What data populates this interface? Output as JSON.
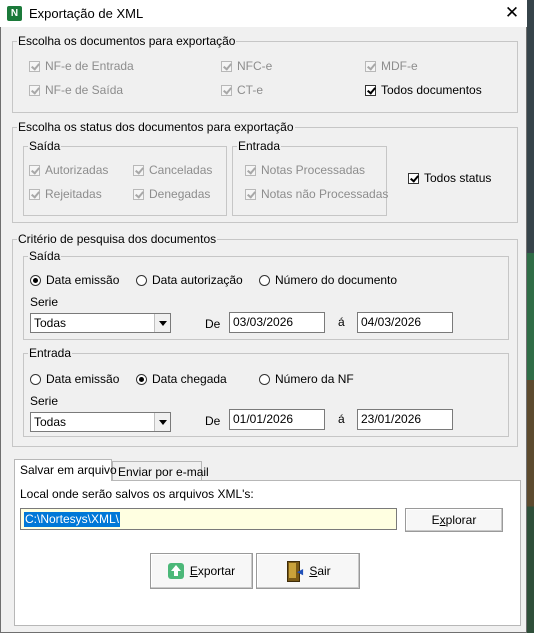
{
  "window": {
    "title": "Exportação de XML",
    "close_glyph": "✕",
    "app_icon_glyph": "N"
  },
  "docs": {
    "legend": "Escolha os documentos para exportação",
    "nfe_entrada": {
      "label": "NF-e de Entrada",
      "checked": true,
      "enabled": false
    },
    "nfce": {
      "label": "NFC-e",
      "checked": true,
      "enabled": false
    },
    "mdfe": {
      "label": "MDF-e",
      "checked": true,
      "enabled": false
    },
    "nfe_saida": {
      "label": "NF-e de Saída",
      "checked": true,
      "enabled": false
    },
    "cte": {
      "label": "CT-e",
      "checked": true,
      "enabled": false
    },
    "todos": {
      "label": "Todos documentos",
      "checked": true,
      "enabled": true
    }
  },
  "status": {
    "legend": "Escolha os status dos documentos para exportação",
    "saida": {
      "legend": "Saída",
      "autorizadas": "Autorizadas",
      "canceladas": "Canceladas",
      "rejeitadas": "Rejeitadas",
      "denegadas": "Denegadas"
    },
    "entrada": {
      "legend": "Entrada",
      "processadas": "Notas Processadas",
      "nao_processadas": "Notas não Processadas"
    },
    "todos": "Todos status"
  },
  "criterio": {
    "legend": "Critério de pesquisa dos documentos",
    "saida": {
      "legend": "Saída",
      "opt1": "Data emissão",
      "opt2": "Data autorização",
      "opt3": "Número do documento",
      "selected": "Data emissão",
      "serie_label": "Serie",
      "serie_value": "Todas",
      "de_label": "De",
      "date_from": "03/03/2026",
      "a_label": "á",
      "date_to": "04/03/2026"
    },
    "entrada": {
      "legend": "Entrada",
      "opt1": "Data emissão",
      "opt2": "Data chegada",
      "opt3": "Número da NF",
      "selected": "Data chegada",
      "serie_label": "Serie",
      "serie_value": "Todas",
      "de_label": "De",
      "date_from": "01/01/2026",
      "a_label": "á",
      "date_to": "23/01/2026"
    }
  },
  "tabs": [
    {
      "label": "Salvar em arquivo",
      "active": true
    },
    {
      "label": "Enviar por e-mail",
      "active": false
    }
  ],
  "save": {
    "local_label": "Local onde serão salvos os arquivos XML's:",
    "path": "C:\\Nortesys\\XML\\",
    "explore_pre": "E",
    "explore_acc": "x",
    "explore_post": "plorar"
  },
  "buttons": {
    "exportar_acc": "E",
    "exportar_rest": "xportar",
    "sair_acc": "S",
    "sair_rest": "air"
  },
  "colors": {
    "selection": "#0078d7",
    "path_bg": "#ffffe1",
    "icon_green": "#4cb879"
  }
}
